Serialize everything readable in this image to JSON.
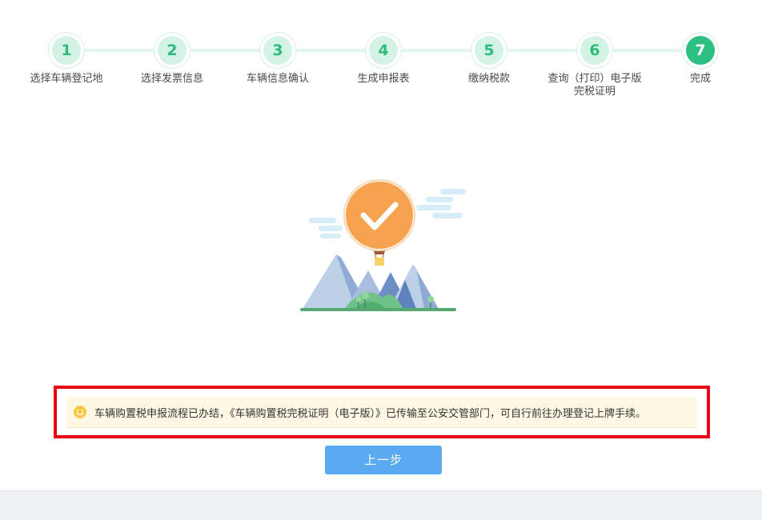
{
  "stepper": {
    "steps": [
      {
        "number": "1",
        "label": "选择车辆登记地",
        "state": "done"
      },
      {
        "number": "2",
        "label": "选择发票信息",
        "state": "done"
      },
      {
        "number": "3",
        "label": "车辆信息确认",
        "state": "done"
      },
      {
        "number": "4",
        "label": "生成申报表",
        "state": "done"
      },
      {
        "number": "5",
        "label": "缴纳税款",
        "state": "done"
      },
      {
        "number": "6",
        "label": "查询（打印）电子版",
        "label_line2": "完税证明",
        "state": "done"
      },
      {
        "number": "7",
        "label": "完成",
        "state": "active"
      }
    ]
  },
  "notice": {
    "text": "车辆购置税申报流程已办结，《车辆购置税完税证明（电子版）》已传输至公安交管部门，可自行前往办理登记上牌手续。",
    "icon": "smiley-icon"
  },
  "actions": {
    "prev_label": "上一步"
  },
  "colors": {
    "accent_green": "#2cbf80",
    "step_light_green": "#d4f2e5",
    "button_blue": "#5aaaf2",
    "highlight_red": "#e60012",
    "notice_bg": "#fff8e5"
  }
}
